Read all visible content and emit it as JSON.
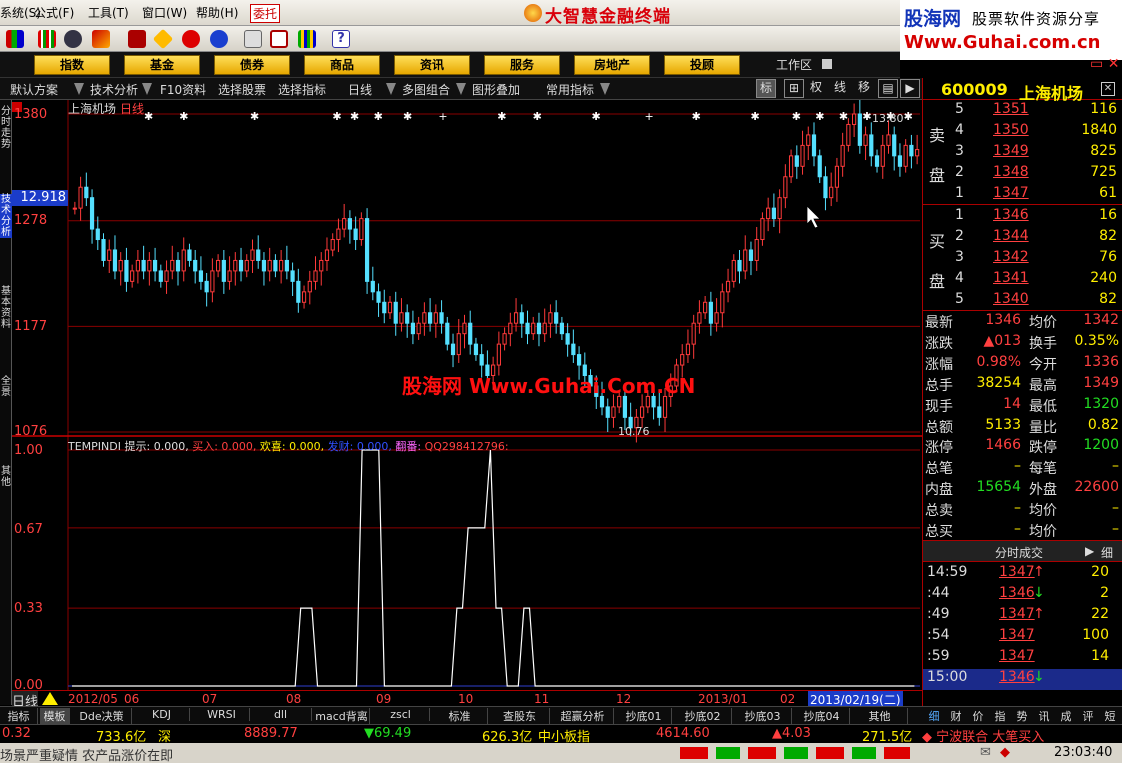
{
  "menu": {
    "items": [
      "系统(S)",
      "公式(F)",
      "工具(T)",
      "窗口(W)",
      "帮助(H)",
      "委托"
    ],
    "app_title": "大智慧金融终端"
  },
  "logo": {
    "main": "股海网",
    "sub": "股票软件资源分享",
    "url": "Www.Guhai.com.cn"
  },
  "categories": [
    "指数",
    "基金",
    "债券",
    "商品",
    "资讯",
    "服务",
    "房地产",
    "投顾"
  ],
  "workarea": "工作区",
  "funcbar": {
    "items": [
      "默认方案",
      "技术分析",
      "F10资料",
      "选择股票",
      "选择指标",
      "日线",
      "多图组合",
      "图形叠加",
      "常用指标"
    ],
    "tools": [
      "标",
      "线",
      "权",
      "线",
      "移"
    ]
  },
  "left_tabs": [
    "分时走势",
    "技术分析",
    "基本资料",
    "全景",
    "其他"
  ],
  "chart": {
    "stock_title": "上海机场",
    "period": "日线",
    "cursor_price": "12.918",
    "price_axis": [
      "1380",
      "1278",
      "1177",
      "1076"
    ],
    "high_mark": "13.80",
    "low_mark": "10.76",
    "watermark": "股海网 Www.Guhai.Com.CN",
    "indicator_line": {
      "name": "TEMPINDI",
      "hint_label": "提示:",
      "hint": "0.000,",
      "buy_label": "买入:",
      "buy": "0.000,",
      "joy_label": "欢喜:",
      "joy": "0.000,",
      "rich_label": "发财:",
      "rich": "0.000,",
      "flip_label": "翻番:",
      "qq": "QQ298412796:"
    },
    "indicator_axis": [
      "1.00",
      "0.67",
      "0.33",
      "0.00"
    ],
    "x_axis": {
      "period_label": "日线",
      "labels": [
        "2012/05",
        "06",
        "07",
        "08",
        "09",
        "10",
        "11",
        "12",
        "2013/01",
        "02"
      ],
      "cursor_date": "2013/02/19(二)"
    }
  },
  "chart_data": [
    {
      "type": "candlestick",
      "title": "上海机场 日线",
      "ylim": [
        10.76,
        13.8
      ],
      "y_ticks": [
        13.8,
        12.78,
        11.77,
        10.76
      ],
      "closes": [
        12.9,
        13.1,
        13.0,
        12.7,
        12.6,
        12.4,
        12.5,
        12.3,
        12.4,
        12.2,
        12.3,
        12.4,
        12.3,
        12.4,
        12.3,
        12.2,
        12.3,
        12.4,
        12.3,
        12.5,
        12.4,
        12.3,
        12.2,
        12.1,
        12.3,
        12.4,
        12.2,
        12.3,
        12.4,
        12.3,
        12.4,
        12.5,
        12.4,
        12.3,
        12.4,
        12.3,
        12.4,
        12.3,
        12.2,
        12.0,
        12.1,
        12.2,
        12.3,
        12.4,
        12.5,
        12.6,
        12.7,
        12.8,
        12.7,
        12.6,
        12.8,
        12.2,
        12.1,
        12.0,
        11.9,
        12.0,
        11.8,
        11.9,
        11.8,
        11.7,
        11.8,
        11.9,
        11.8,
        11.9,
        11.8,
        11.6,
        11.5,
        11.7,
        11.8,
        11.6,
        11.5,
        11.4,
        11.3,
        11.4,
        11.6,
        11.7,
        11.8,
        11.9,
        11.8,
        11.7,
        11.8,
        11.7,
        11.8,
        11.9,
        11.8,
        11.7,
        11.6,
        11.5,
        11.4,
        11.3,
        11.2,
        11.1,
        11.0,
        10.9,
        11.0,
        11.1,
        10.9,
        10.8,
        10.9,
        11.0,
        11.1,
        11.0,
        10.9,
        11.1,
        11.2,
        11.4,
        11.5,
        11.6,
        11.8,
        11.9,
        12.0,
        11.8,
        11.9,
        12.1,
        12.2,
        12.4,
        12.3,
        12.5,
        12.4,
        12.6,
        12.8,
        12.9,
        12.8,
        13.0,
        13.2,
        13.4,
        13.3,
        13.5,
        13.6,
        13.4,
        13.2,
        13.0,
        13.1,
        13.3,
        13.5,
        13.7,
        13.8,
        13.5,
        13.6,
        13.4,
        13.3,
        13.5,
        13.6,
        13.4,
        13.3,
        13.5,
        13.4,
        13.46
      ]
    },
    {
      "type": "line",
      "title": "TEMPINDI",
      "ylim": [
        0,
        1
      ],
      "y_ticks": [
        1.0,
        0.67,
        0.33,
        0.0
      ],
      "values": [
        0,
        0,
        0,
        0,
        0,
        0,
        0,
        0,
        0,
        0,
        0,
        0,
        0,
        0,
        0,
        0,
        0,
        0,
        0,
        0,
        0,
        0,
        0,
        0,
        0,
        0,
        0,
        0,
        0,
        0,
        0,
        0,
        0,
        0,
        0,
        0,
        0,
        0,
        0,
        0,
        0,
        0.33,
        0.33,
        0.33,
        0,
        0,
        0,
        0,
        0,
        0,
        0,
        0,
        1,
        1,
        1,
        1,
        0,
        0,
        0,
        0,
        0,
        0,
        0,
        0,
        0,
        0,
        0,
        0,
        0,
        0.33,
        0.33,
        0.67,
        0.67,
        0.67,
        0.67,
        1,
        0.33,
        0.33,
        0,
        0,
        0,
        0.33,
        0.33,
        0,
        0,
        0,
        0,
        0,
        0,
        0,
        0,
        0,
        0,
        0,
        0,
        0,
        0,
        0,
        0,
        0,
        0,
        0,
        0,
        0,
        0,
        0,
        0,
        0,
        0,
        0,
        0,
        0,
        0,
        0,
        0,
        0,
        0,
        0,
        0,
        0,
        0,
        0,
        0,
        0,
        0,
        0,
        0,
        0,
        0,
        0,
        0,
        0,
        0,
        0,
        0,
        0,
        0,
        0,
        0,
        0,
        0,
        0,
        0,
        0,
        0,
        0,
        0,
        0,
        0,
        0,
        0,
        0
      ]
    }
  ],
  "quote": {
    "code": "600009",
    "name": "上海机场",
    "sell_label": [
      "卖",
      "盘"
    ],
    "buy_label": [
      "买",
      "盘"
    ],
    "asks": [
      {
        "level": "5",
        "price": "1351",
        "vol": "116"
      },
      {
        "level": "4",
        "price": "1350",
        "vol": "1840"
      },
      {
        "level": "3",
        "price": "1349",
        "vol": "825"
      },
      {
        "level": "2",
        "price": "1348",
        "vol": "725"
      },
      {
        "level": "1",
        "price": "1347",
        "vol": "61"
      }
    ],
    "bids": [
      {
        "level": "1",
        "price": "1346",
        "vol": "16"
      },
      {
        "level": "2",
        "price": "1344",
        "vol": "82"
      },
      {
        "level": "3",
        "price": "1342",
        "vol": "76"
      },
      {
        "level": "4",
        "price": "1341",
        "vol": "240"
      },
      {
        "level": "5",
        "price": "1340",
        "vol": "82"
      }
    ],
    "stats": [
      {
        "l1": "最新",
        "v1": "1346",
        "c1": "red",
        "l2": "均价",
        "v2": "1342",
        "c2": "red"
      },
      {
        "l1": "涨跌",
        "v1": "▲013",
        "c1": "red",
        "l2": "换手",
        "v2": "0.35%",
        "c2": "yel"
      },
      {
        "l1": "涨幅",
        "v1": "0.98%",
        "c1": "red",
        "l2": "今开",
        "v2": "1336",
        "c2": "red"
      },
      {
        "l1": "总手",
        "v1": "38254",
        "c1": "yel",
        "l2": "最高",
        "v2": "1349",
        "c2": "red"
      },
      {
        "l1": "现手",
        "v1": "14",
        "c1": "red",
        "l2": "最低",
        "v2": "1320",
        "c2": "grn"
      },
      {
        "l1": "总额",
        "v1": "5133",
        "c1": "yel",
        "l2": "量比",
        "v2": "0.82",
        "c2": "yel"
      },
      {
        "l1": "涨停",
        "v1": "1466",
        "c1": "red",
        "l2": "跌停",
        "v2": "1200",
        "c2": "grn"
      },
      {
        "l1": "总笔",
        "v1": "–",
        "c1": "yel",
        "l2": "每笔",
        "v2": "–",
        "c2": "yel"
      },
      {
        "l1": "内盘",
        "v1": "15654",
        "c1": "grn",
        "l2": "外盘",
        "v2": "22600",
        "c2": "red"
      },
      {
        "l1": "总卖",
        "v1": "–",
        "c1": "yel",
        "l2": "均价",
        "v2": "–",
        "c2": "yel"
      },
      {
        "l1": "总买",
        "v1": "–",
        "c1": "yel",
        "l2": "均价",
        "v2": "–",
        "c2": "yel"
      }
    ],
    "ticks_title": "分时成交",
    "ticks_detail": "细",
    "ticks": [
      {
        "time": "14:59",
        "price": "1347",
        "dir": "up",
        "vol": "20"
      },
      {
        "time": ":44",
        "price": "1346",
        "dir": "down",
        "vol": "2"
      },
      {
        "time": ":49",
        "price": "1347",
        "dir": "up",
        "vol": "22"
      },
      {
        "time": ":54",
        "price": "1347",
        "dir": "",
        "vol": "100"
      },
      {
        "time": ":59",
        "price": "1347",
        "dir": "",
        "vol": "14"
      },
      {
        "time": "15:00",
        "price": "1346",
        "dir": "down",
        "vol": ""
      }
    ],
    "bottom_tabs": [
      "细",
      "财",
      "价",
      "指",
      "势",
      "讯",
      "成",
      "评",
      "短"
    ]
  },
  "bottom_tabs": [
    "指标",
    "模板",
    "Dde决策",
    "KDJ",
    "WRSI",
    "dll",
    "macd背离",
    "zscl",
    "标准",
    "查股东",
    "超赢分析",
    "抄底01",
    "抄底02",
    "抄底03",
    "抄底04",
    "其他"
  ],
  "status": {
    "a": "0.32",
    "b": "733.6亿",
    "c": "深",
    "d": "8889.77",
    "e": "▼69.49",
    "f": "626.3亿",
    "g": "中小板指",
    "h": "4614.60",
    "i": "▲4.03",
    "j": "271.5亿",
    "k": "◆ 宁波联合 大笔买入",
    "news": "场景严重疑情 农产品涨价在即",
    "clock": "23:03:40"
  },
  "colors": {
    "up": "#ff3a3a",
    "down": "#55e0ff",
    "accent": "#ffee00",
    "grid": "#8a0000"
  }
}
